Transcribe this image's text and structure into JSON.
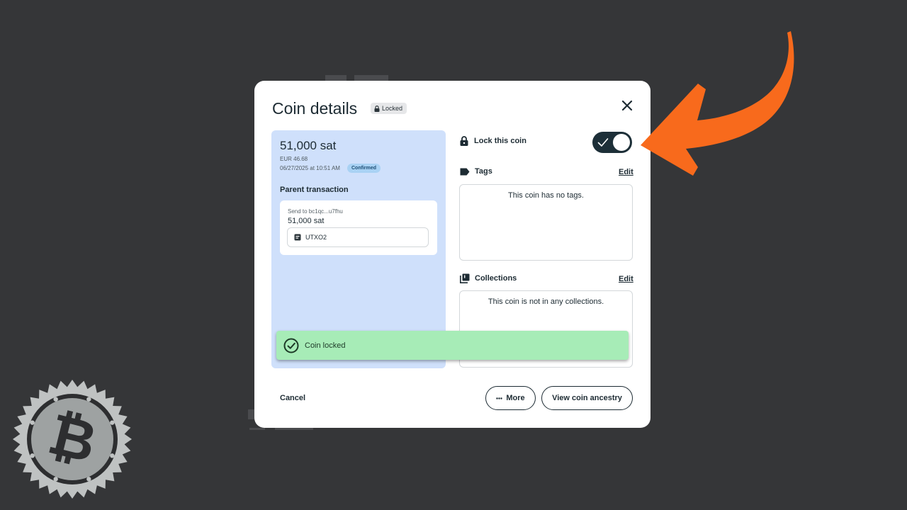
{
  "modal": {
    "title": "Coin details",
    "locked_badge": "Locked",
    "coin": {
      "amount": "51,000  sat",
      "fiat": "EUR 46.68",
      "date": "06/27/2025 at 10:51 AM",
      "status": "Confirmed"
    },
    "parent_transaction": {
      "label": "Parent transaction",
      "send_to": "Send to bc1qc...u7fhu",
      "amount": "51,000  sat",
      "utxo_label": "UTXO2"
    },
    "lock": {
      "label": "Lock this coin",
      "enabled": true
    },
    "tags": {
      "label": "Tags",
      "edit_label": "Edit",
      "empty_text": "This coin has no tags."
    },
    "collections": {
      "label": "Collections",
      "edit_label": "Edit",
      "empty_text": "This coin is not in any collections."
    },
    "footer": {
      "cancel_label": "Cancel",
      "more_label": "More",
      "ancestry_label": "View coin ancestry"
    }
  },
  "toast": {
    "message": "Coin locked"
  },
  "colors": {
    "background": "#353638",
    "toggle_on": "#1d2f38",
    "toast": "#a7ecb7",
    "arrow": "#f86a1c",
    "left_panel": "#cfe0fb"
  }
}
